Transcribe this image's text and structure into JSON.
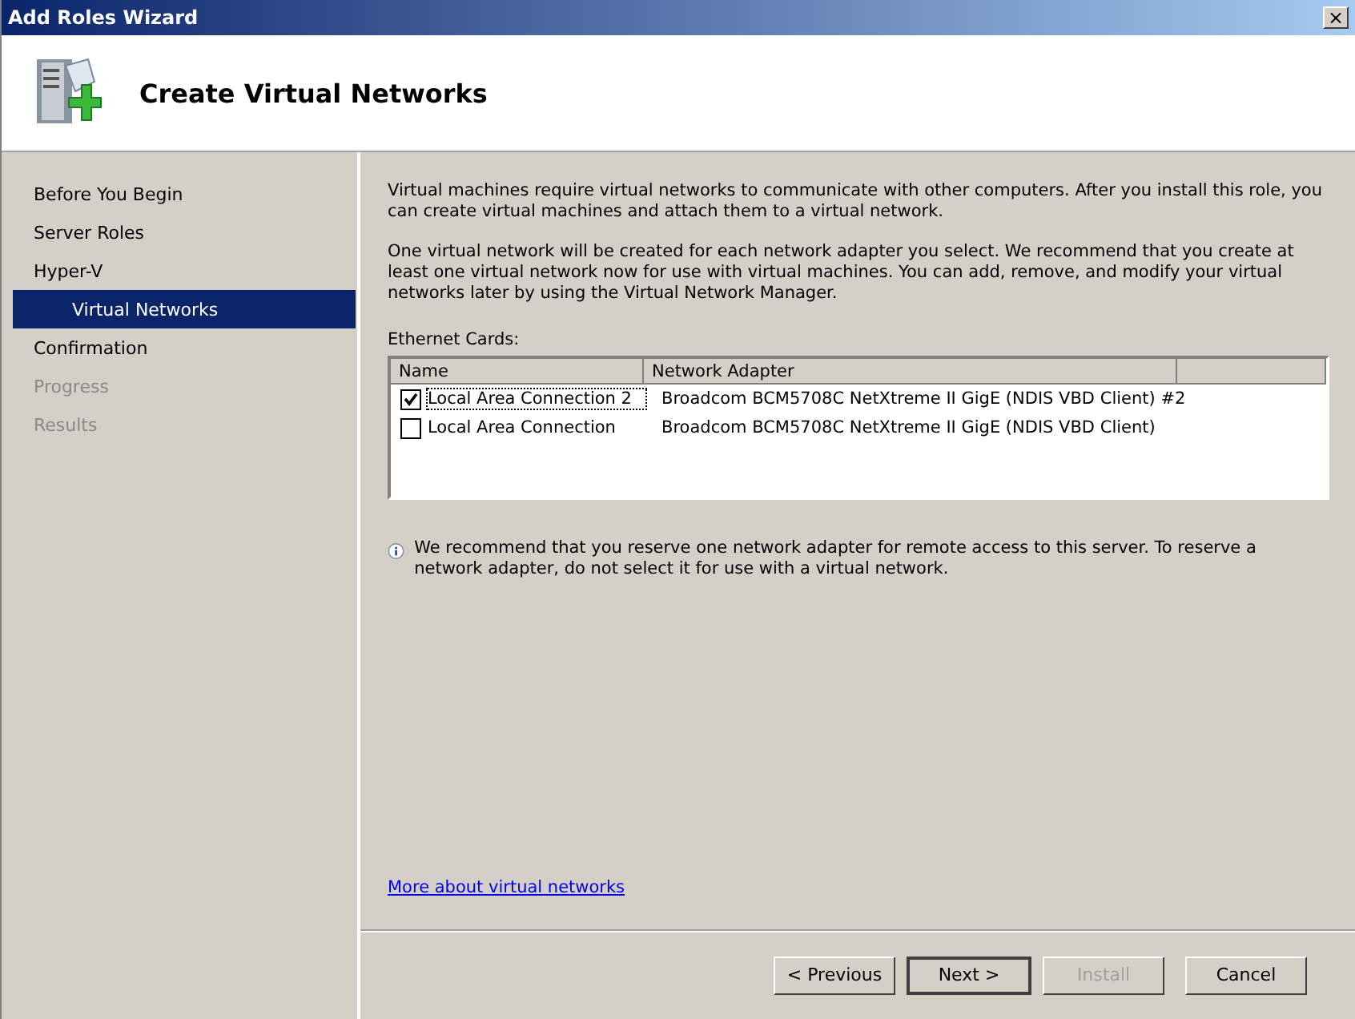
{
  "window": {
    "title": "Add Roles Wizard",
    "close": "×"
  },
  "header": {
    "title": "Create Virtual Networks"
  },
  "sidebar": {
    "items": [
      {
        "label": "Before You Begin",
        "selected": false,
        "disabled": false,
        "indented": false
      },
      {
        "label": "Server Roles",
        "selected": false,
        "disabled": false,
        "indented": false
      },
      {
        "label": "Hyper-V",
        "selected": false,
        "disabled": false,
        "indented": false
      },
      {
        "label": "Virtual Networks",
        "selected": true,
        "disabled": false,
        "indented": true
      },
      {
        "label": "Confirmation",
        "selected": false,
        "disabled": false,
        "indented": false
      },
      {
        "label": "Progress",
        "selected": false,
        "disabled": true,
        "indented": false
      },
      {
        "label": "Results",
        "selected": false,
        "disabled": true,
        "indented": false
      }
    ]
  },
  "content": {
    "paragraphs": [
      "Virtual machines require virtual networks to communicate with other computers. After you install this role, you can create virtual machines and attach them to a virtual network.",
      "One virtual network will be created for each network adapter you select. We recommend that you create at least one virtual network now for use with virtual machines. You can add, remove, and modify your virtual networks later by using the Virtual Network Manager."
    ],
    "list_label": "Ethernet Cards:",
    "table": {
      "columns": [
        "Name",
        "Network Adapter"
      ],
      "rows": [
        {
          "name": "Local Area Connection 2",
          "adapter": "Broadcom BCM5708C NetXtreme II GigE (NDIS VBD Client) #2",
          "checked": true,
          "focused": true
        },
        {
          "name": "Local Area Connection",
          "adapter": "Broadcom BCM5708C NetXtreme II GigE (NDIS VBD Client)",
          "checked": false,
          "focused": false
        }
      ]
    },
    "note": "We recommend that you reserve one network adapter for remote access to this server. To reserve a network adapter, do not select it for use with a virtual network.",
    "link": "More about virtual networks"
  },
  "buttons": [
    {
      "label": "< Previous",
      "disabled": false,
      "default": false
    },
    {
      "label": "Next >",
      "disabled": false,
      "default": true
    },
    {
      "label": "Install",
      "disabled": true,
      "default": false
    },
    {
      "label": "Cancel",
      "disabled": false,
      "default": false
    }
  ]
}
